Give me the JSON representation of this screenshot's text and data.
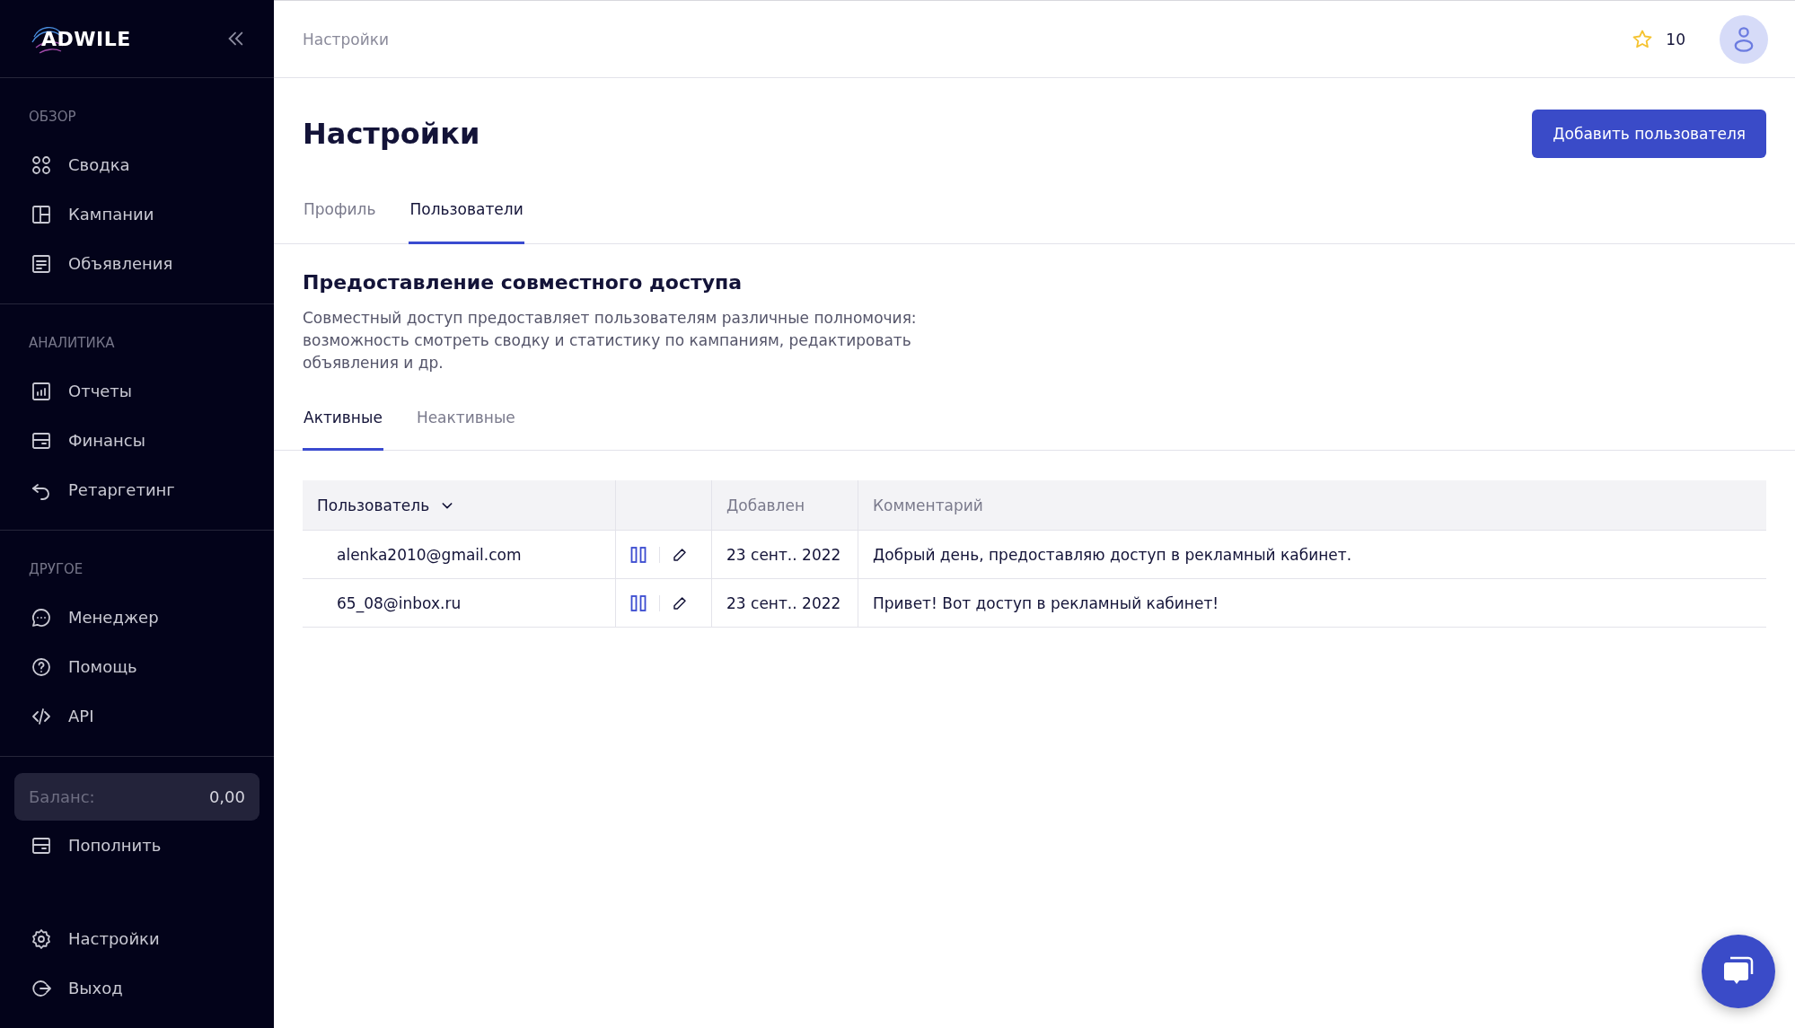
{
  "sidebar": {
    "logo": "ADWILE",
    "sections": [
      {
        "label": "ОБЗОР",
        "items": [
          {
            "label": "Сводка"
          },
          {
            "label": "Кампании"
          },
          {
            "label": "Объявления"
          }
        ]
      },
      {
        "label": "АНАЛИТИКА",
        "items": [
          {
            "label": "Отчеты"
          },
          {
            "label": "Финансы"
          },
          {
            "label": "Ретаргетинг"
          }
        ]
      },
      {
        "label": "ДРУГОЕ",
        "items": [
          {
            "label": "Менеджер"
          },
          {
            "label": "Помощь"
          },
          {
            "label": "API"
          }
        ]
      }
    ],
    "balance": {
      "label": "Баланс:",
      "value": "0,00"
    },
    "top_up": {
      "label": "Пополнить"
    },
    "bottom_items": [
      {
        "label": "Настройки"
      },
      {
        "label": "Выход"
      }
    ]
  },
  "topbar": {
    "breadcrumb": "Настройки",
    "stars_count": "10"
  },
  "page": {
    "title": "Настройки",
    "add_button": "Добавить пользователя",
    "tabs": [
      {
        "label": "Профиль",
        "selected": false
      },
      {
        "label": "Пользователи",
        "selected": true
      }
    ],
    "section": {
      "heading": "Предоставление совместного доступа",
      "description": "Совместный доступ предоставляет пользователям различные полномочия: возможность смотреть сводку и статистику по кампаниям, редактировать объявления и др."
    },
    "subtabs": [
      {
        "label": "Активные",
        "selected": true
      },
      {
        "label": "Неактивные",
        "selected": false
      }
    ],
    "table": {
      "columns": [
        {
          "label": "Пользователь",
          "sorted": true
        },
        {
          "label": "Добавлен",
          "sorted": false
        },
        {
          "label": "Комментарий",
          "sorted": false
        }
      ],
      "rows": [
        {
          "user": "alenka2010@gmail.com",
          "added": "23 сент.. 2022",
          "comment": "Добрый день, предоставляю доступ в рекламный кабинет."
        },
        {
          "user": "65_08@inbox.ru",
          "added": "23 сент.. 2022",
          "comment": "Привет! Вот доступ в рекламный кабинет!"
        }
      ]
    }
  }
}
